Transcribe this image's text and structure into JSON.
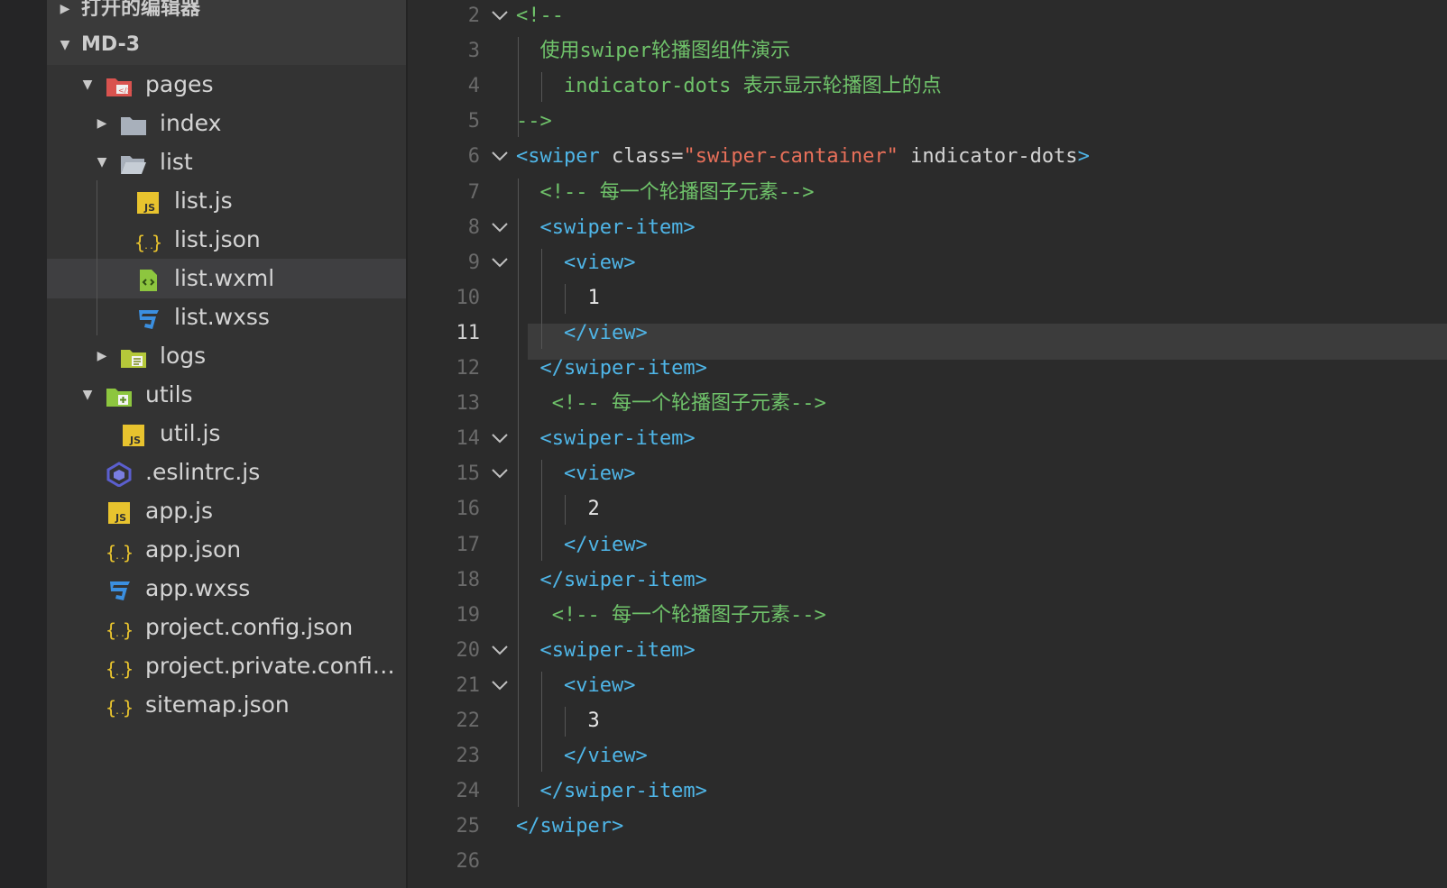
{
  "sidebar": {
    "section_open_editors": "打开的编辑器",
    "section_project": "MD-3",
    "tree": [
      {
        "label": "pages",
        "icon": "folder-pages-icon",
        "arrow": "open",
        "level": 1
      },
      {
        "label": "index",
        "icon": "folder-icon",
        "arrow": "closed",
        "level": 2
      },
      {
        "label": "list",
        "icon": "folder-open-icon",
        "arrow": "open",
        "level": 2
      },
      {
        "label": "list.js",
        "icon": "js-file-icon",
        "arrow": "none",
        "level": 3
      },
      {
        "label": "list.json",
        "icon": "json-file-icon",
        "arrow": "none",
        "level": 3
      },
      {
        "label": "list.wxml",
        "icon": "wxml-file-icon",
        "arrow": "none",
        "level": 3,
        "selected": true
      },
      {
        "label": "list.wxss",
        "icon": "wxss-file-icon",
        "arrow": "none",
        "level": 3
      },
      {
        "label": "logs",
        "icon": "folder-logs-icon",
        "arrow": "closed",
        "level": 2
      },
      {
        "label": "utils",
        "icon": "folder-utils-icon",
        "arrow": "open",
        "level": 1
      },
      {
        "label": "util.js",
        "icon": "js-file-icon",
        "arrow": "none",
        "level": 2
      },
      {
        "label": ".eslintrc.js",
        "icon": "eslint-file-icon",
        "arrow": "none",
        "level": 1
      },
      {
        "label": "app.js",
        "icon": "js-file-icon",
        "arrow": "none",
        "level": 1
      },
      {
        "label": "app.json",
        "icon": "json-file-icon",
        "arrow": "none",
        "level": 1
      },
      {
        "label": "app.wxss",
        "icon": "wxss-file-icon",
        "arrow": "none",
        "level": 1
      },
      {
        "label": "project.config.json",
        "icon": "json-file-icon",
        "arrow": "none",
        "level": 1
      },
      {
        "label": "project.private.config.js...",
        "icon": "json-file-icon",
        "arrow": "none",
        "level": 1
      },
      {
        "label": "sitemap.json",
        "icon": "json-file-icon",
        "arrow": "none",
        "level": 1
      }
    ]
  },
  "editor": {
    "active_line": 11,
    "lines": [
      {
        "n": "2",
        "fold": true,
        "parts": [
          [
            "c-comment",
            "<!--"
          ]
        ]
      },
      {
        "n": "3",
        "fold": false,
        "parts": [
          [
            "c-comment",
            "  使用swiper轮播图组件演示"
          ]
        ]
      },
      {
        "n": "4",
        "fold": false,
        "parts": [
          [
            "c-comment",
            "    indicator-dots 表示显示轮播图上的点"
          ]
        ]
      },
      {
        "n": "5",
        "fold": false,
        "parts": [
          [
            "c-comment",
            "-->"
          ]
        ]
      },
      {
        "n": "6",
        "fold": true,
        "parts": [
          [
            "c-tag",
            "<swiper "
          ],
          [
            "c-attr",
            "class="
          ],
          [
            "c-str",
            "\"swiper-cantainer\""
          ],
          [
            "c-attr",
            " indicator-dots"
          ],
          [
            "c-tag",
            ">"
          ]
        ]
      },
      {
        "n": "7",
        "fold": false,
        "parts": [
          [
            "c-comment",
            "  <!-- 每一个轮播图子元素-->"
          ]
        ]
      },
      {
        "n": "8",
        "fold": true,
        "parts": [
          [
            "c-tag",
            "  <swiper-item>"
          ]
        ]
      },
      {
        "n": "9",
        "fold": true,
        "parts": [
          [
            "c-tag",
            "    <view>"
          ]
        ]
      },
      {
        "n": "10",
        "fold": false,
        "parts": [
          [
            "c-text",
            "      1"
          ]
        ]
      },
      {
        "n": "11",
        "fold": false,
        "parts": [
          [
            "c-tag",
            "    </view>"
          ]
        ]
      },
      {
        "n": "12",
        "fold": false,
        "parts": [
          [
            "c-tag",
            "  </swiper-item>"
          ]
        ]
      },
      {
        "n": "13",
        "fold": false,
        "parts": [
          [
            "c-comment",
            "   <!-- 每一个轮播图子元素-->"
          ]
        ]
      },
      {
        "n": "14",
        "fold": true,
        "parts": [
          [
            "c-tag",
            "  <swiper-item>"
          ]
        ]
      },
      {
        "n": "15",
        "fold": true,
        "parts": [
          [
            "c-tag",
            "    <view>"
          ]
        ]
      },
      {
        "n": "16",
        "fold": false,
        "parts": [
          [
            "c-text",
            "      2"
          ]
        ]
      },
      {
        "n": "17",
        "fold": false,
        "parts": [
          [
            "c-tag",
            "    </view>"
          ]
        ]
      },
      {
        "n": "18",
        "fold": false,
        "parts": [
          [
            "c-tag",
            "  </swiper-item>"
          ]
        ]
      },
      {
        "n": "19",
        "fold": false,
        "parts": [
          [
            "c-comment",
            "   <!-- 每一个轮播图子元素-->"
          ]
        ]
      },
      {
        "n": "20",
        "fold": true,
        "parts": [
          [
            "c-tag",
            "  <swiper-item>"
          ]
        ]
      },
      {
        "n": "21",
        "fold": true,
        "parts": [
          [
            "c-tag",
            "    <view>"
          ]
        ]
      },
      {
        "n": "22",
        "fold": false,
        "parts": [
          [
            "c-text",
            "      3"
          ]
        ]
      },
      {
        "n": "23",
        "fold": false,
        "parts": [
          [
            "c-tag",
            "    </view>"
          ]
        ]
      },
      {
        "n": "24",
        "fold": false,
        "parts": [
          [
            "c-tag",
            "  </swiper-item>"
          ]
        ]
      },
      {
        "n": "25",
        "fold": false,
        "parts": [
          [
            "c-tag",
            "</swiper>"
          ]
        ]
      },
      {
        "n": "26",
        "fold": false,
        "parts": []
      }
    ]
  }
}
